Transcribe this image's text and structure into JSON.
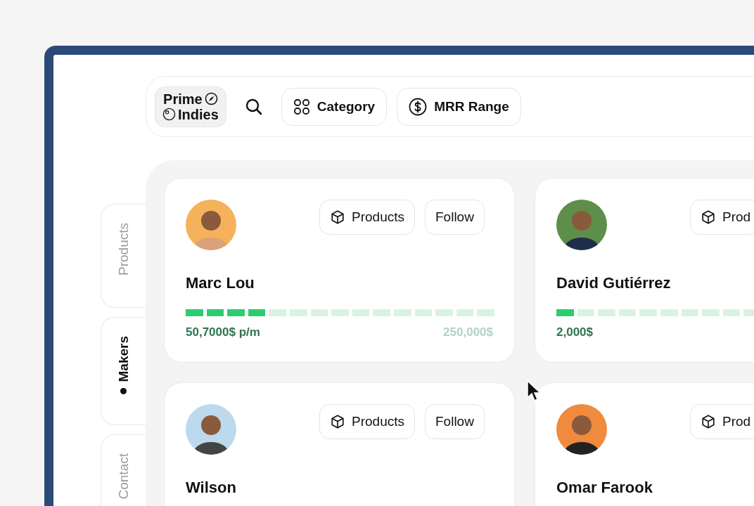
{
  "topbar": {
    "logo": {
      "line_1": "Prime",
      "line_2": "Indies"
    },
    "filters": [
      {
        "label": "Category",
        "kind": "category"
      },
      {
        "label": "MRR Range",
        "kind": "money"
      }
    ]
  },
  "side_tabs": [
    {
      "label": "Products",
      "selected": false
    },
    {
      "label": "Makers",
      "selected": true
    },
    {
      "label": "Contact",
      "selected": false
    }
  ],
  "makers": [
    {
      "name": "Marc Lou",
      "products_label": "Products",
      "follow_label": "Follow",
      "level": 0.27,
      "mrr": "50,7000$ p/m",
      "goal": "250,000$"
    },
    {
      "name": "David Gutiérrez",
      "products_label": "Prod",
      "level": 0.07,
      "mrr": "2,000$"
    },
    {
      "name": "Wilson",
      "products_label": "Products",
      "follow_label": "Follow"
    },
    {
      "name": "Omar Farook",
      "products_label": "Prod"
    }
  ]
}
